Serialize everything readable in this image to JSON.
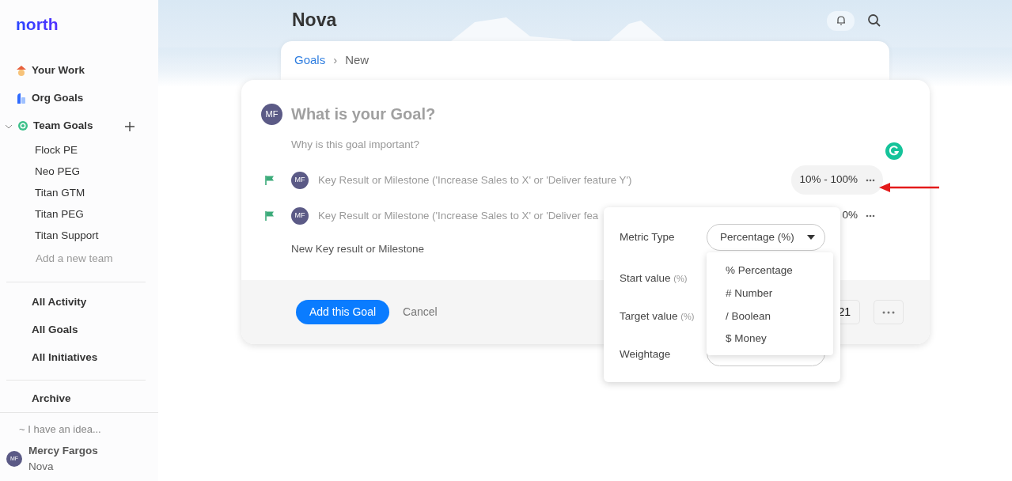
{
  "sidebar": {
    "logo": "north",
    "nav": [
      {
        "label": "Your Work"
      },
      {
        "label": "Org Goals"
      },
      {
        "label": "Team Goals",
        "expanded": true,
        "children": [
          {
            "label": "Flock PE"
          },
          {
            "label": "Neo PEG"
          },
          {
            "label": "Titan GTM"
          },
          {
            "label": "Titan PEG"
          },
          {
            "label": "Titan Support"
          }
        ]
      }
    ],
    "add_team": "Add a new team",
    "links": [
      "All Activity",
      "All Goals",
      "All Initiatives"
    ],
    "archive": "Archive",
    "idea": "~ I have an idea...",
    "user": {
      "initials": "MF",
      "name": "Mercy Fargos",
      "workspace": "Nova"
    }
  },
  "header": {
    "title": "Nova"
  },
  "breadcrumb": {
    "items": [
      "Goals",
      "New"
    ],
    "separator": "›"
  },
  "goal_form": {
    "avatar": "MF",
    "title_placeholder": "What is your Goal?",
    "why_placeholder": "Why is this goal important?",
    "key_results": [
      {
        "avatar": "MF",
        "text": "Key Result or Milestone ('Increase Sales to X' or 'Deliver feature Y')",
        "range": "10% - 100%",
        "highlighted": true
      },
      {
        "avatar": "MF",
        "text": "Key Result or Milestone ('Increase Sales to X' or 'Deliver fea",
        "range": "0%",
        "highlighted": false
      }
    ],
    "new_key_result": "New Key result or Milestone",
    "submit": "Add this Goal",
    "cancel": "Cancel",
    "date": "21"
  },
  "metric_popover": {
    "fields": [
      {
        "label": "Metric Type",
        "kind": "select",
        "value": "Percentage (%)"
      },
      {
        "label": "Start value",
        "unit": "(%)",
        "kind": "hidden"
      },
      {
        "label": "Target value",
        "unit": "(%)",
        "kind": "hidden"
      },
      {
        "label": "Weightage",
        "kind": "pill"
      }
    ],
    "options": [
      "% Percentage",
      "# Number",
      "/ Boolean",
      "$ Money"
    ]
  }
}
